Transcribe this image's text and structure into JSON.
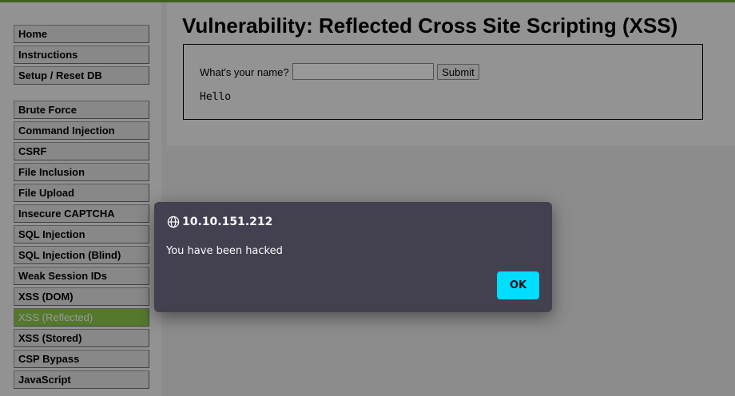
{
  "menu": {
    "group1": [
      "Home",
      "Instructions",
      "Setup / Reset DB"
    ],
    "group2": [
      "Brute Force",
      "Command Injection",
      "CSRF",
      "File Inclusion",
      "File Upload",
      "Insecure CAPTCHA",
      "SQL Injection",
      "SQL Injection (Blind)",
      "Weak Session IDs",
      "XSS (DOM)",
      "XSS (Reflected)",
      "XSS (Stored)",
      "CSP Bypass",
      "JavaScript"
    ],
    "active": "XSS (Reflected)"
  },
  "page": {
    "title": "Vulnerability: Reflected Cross Site Scripting (XSS)",
    "form": {
      "label": "What's your name?",
      "input_value": "",
      "submit_label": "Submit"
    },
    "output": "Hello"
  },
  "alert_dialog": {
    "origin": "10.10.151.212",
    "message": "You have been hacked",
    "ok_label": "OK"
  },
  "colors": {
    "accent_green": "#8cc94a",
    "dialog_bg": "#43404f",
    "ok_button": "#00ddff"
  },
  "icons": {
    "origin": "globe-icon"
  }
}
